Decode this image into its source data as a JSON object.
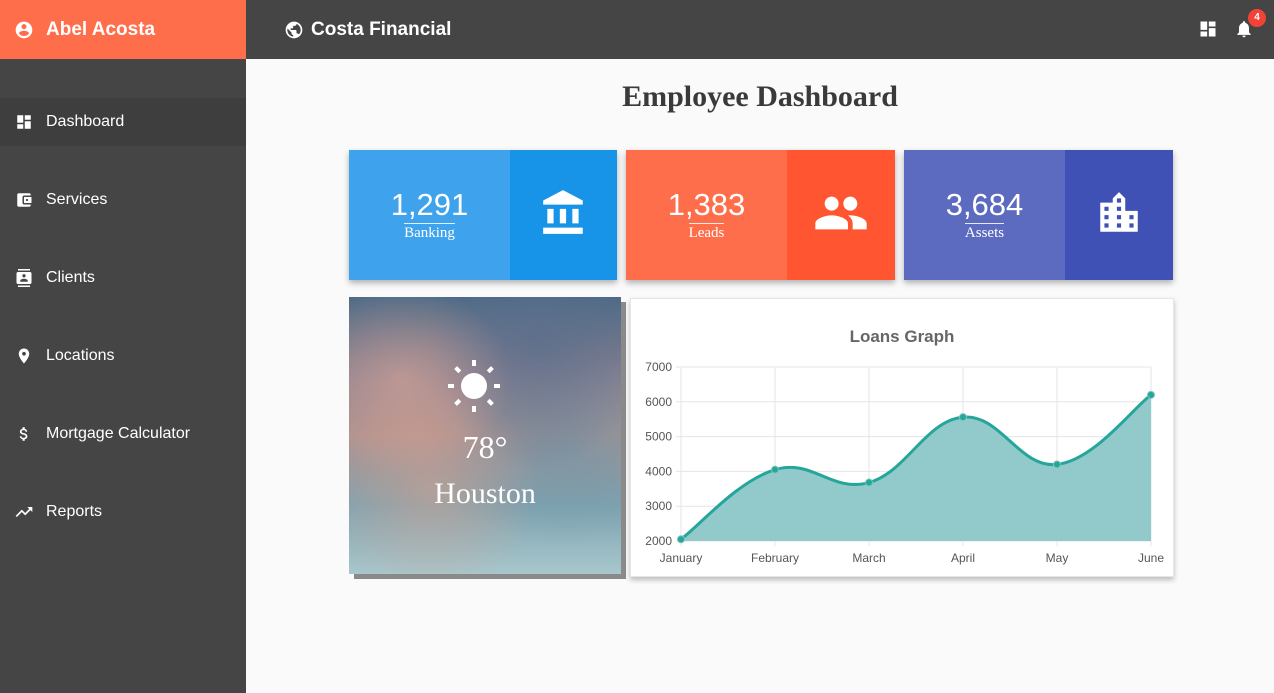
{
  "sidebar": {
    "user_name": "Abel Acosta",
    "items": [
      {
        "label": "Dashboard",
        "icon": "dashboard-icon",
        "active": true
      },
      {
        "label": "Services",
        "icon": "wallet-icon"
      },
      {
        "label": "Clients",
        "icon": "contacts-icon"
      },
      {
        "label": "Locations",
        "icon": "location-pin-icon"
      },
      {
        "label": "Mortgage Calculator",
        "icon": "dollar-icon"
      },
      {
        "label": "Reports",
        "icon": "trending-up-icon"
      }
    ]
  },
  "topbar": {
    "brand": "Costa Financial",
    "notification_count": "4"
  },
  "main": {
    "title": "Employee Dashboard",
    "stats": [
      {
        "value": "1,291",
        "label": "Banking",
        "icon": "bank-icon",
        "color_light": "#3ea2ec",
        "color_dark": "#1794e8"
      },
      {
        "value": "1,383",
        "label": "Leads",
        "icon": "people-icon",
        "color_light": "#ff6e4a",
        "color_dark": "#ff5631"
      },
      {
        "value": "3,684",
        "label": "Assets",
        "icon": "building-icon",
        "color_light": "#5c6bc0",
        "color_dark": "#3f51b5"
      }
    ],
    "weather": {
      "temp": "78°",
      "city": "Houston",
      "icon": "sun-icon"
    }
  },
  "chart_data": {
    "type": "area",
    "title": "Loans Graph",
    "categories": [
      "January",
      "February",
      "March",
      "April",
      "May",
      "June"
    ],
    "values": [
      2050,
      4050,
      3680,
      5560,
      4200,
      6200
    ],
    "ylim": [
      2000,
      7000
    ],
    "yticks": [
      2000,
      3000,
      4000,
      5000,
      6000,
      7000
    ],
    "grid": true,
    "line_color": "#26a69a",
    "fill_color": "#92cacc"
  }
}
